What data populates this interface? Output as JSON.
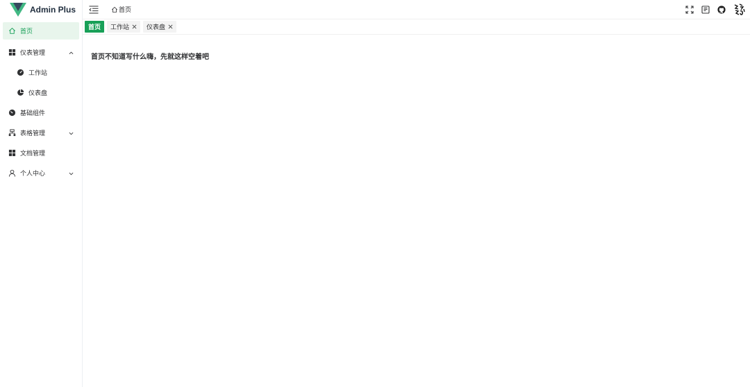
{
  "app": {
    "title": "Admin Plus",
    "accent": "#18a058"
  },
  "sidebar": {
    "items": [
      {
        "label": "首页",
        "icon": "home-icon",
        "active": true
      },
      {
        "label": "仪表管理",
        "icon": "grid-icon",
        "expanded": true
      },
      {
        "label": "工作站",
        "icon": "dashboard-gauge-icon",
        "sub": true
      },
      {
        "label": "仪表盘",
        "icon": "pie-chart-icon",
        "sub": true
      },
      {
        "label": "基础组件",
        "icon": "gauge-icon"
      },
      {
        "label": "表格管理",
        "icon": "table-hierarchy-icon",
        "expanded": false
      },
      {
        "label": "文档管理",
        "icon": "grid-icon"
      },
      {
        "label": "个人中心",
        "icon": "user-icon",
        "expanded": false
      }
    ]
  },
  "header": {
    "breadcrumb": "首页",
    "actions": [
      "fullscreen-icon",
      "document-icon",
      "github-icon"
    ]
  },
  "tabs": [
    {
      "label": "首页",
      "active": true,
      "closable": false
    },
    {
      "label": "工作站",
      "active": false,
      "closable": true
    },
    {
      "label": "仪表盘",
      "active": false,
      "closable": true
    }
  ],
  "main": {
    "message": "首页不知道写什么嗨，先就这样空着吧"
  }
}
